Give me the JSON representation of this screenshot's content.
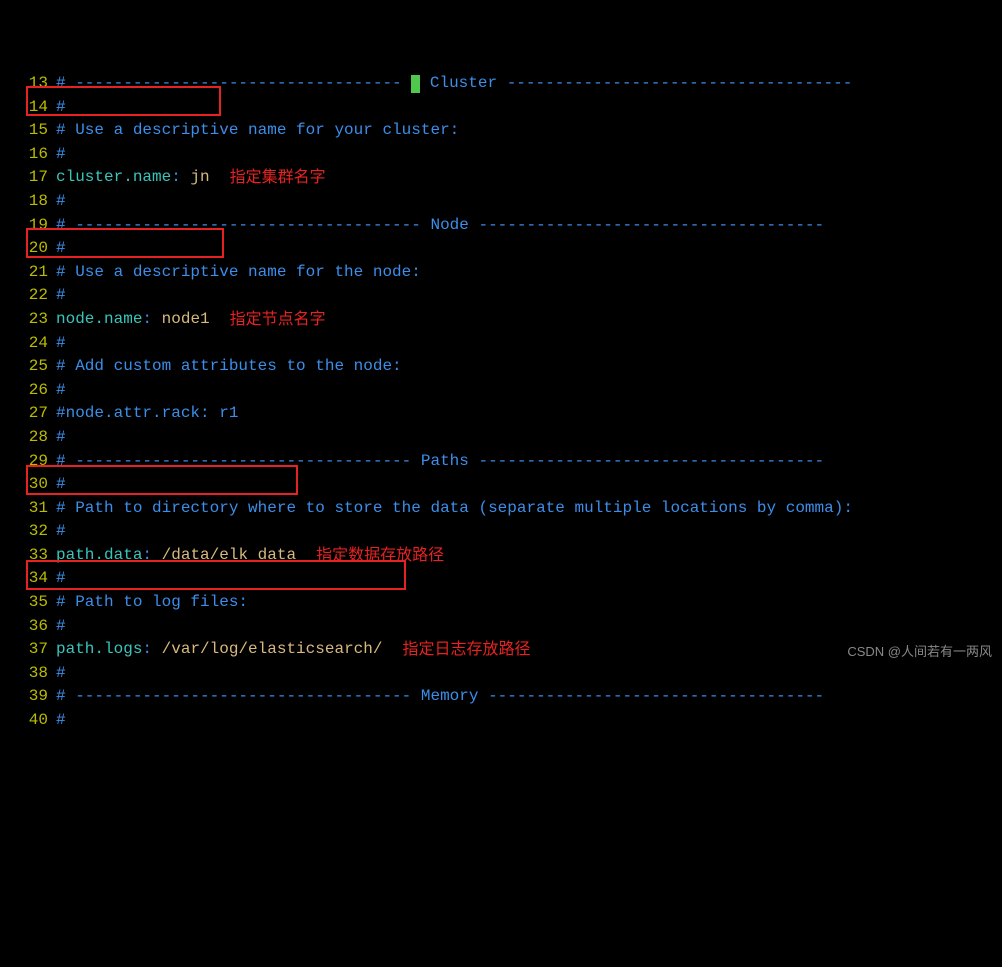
{
  "lines": {
    "13": {
      "num": "13",
      "dash_left": "# ---------------------------------- ",
      "cursor": true,
      "section": " Cluster ",
      "dash_right": "------------------------------------"
    },
    "14": {
      "num": "14",
      "text": "#"
    },
    "15": {
      "num": "15",
      "text": "# Use a descriptive name for your cluster:"
    },
    "16": {
      "num": "16",
      "text": "#"
    },
    "17": {
      "num": "17",
      "key": "cluster.name",
      "colon": ":",
      "value": " jn"
    },
    "18": {
      "num": "18",
      "text": "#"
    },
    "19": {
      "num": "19",
      "dash_left": "# ------------------------------------ ",
      "section": "Node",
      "dash_right": " ------------------------------------"
    },
    "20": {
      "num": "20",
      "text": "#"
    },
    "21": {
      "num": "21",
      "text": "# Use a descriptive name for the node:"
    },
    "22": {
      "num": "22",
      "text": "#"
    },
    "23": {
      "num": "23",
      "key": "node.name",
      "colon": ":",
      "value": " node1"
    },
    "24": {
      "num": "24",
      "text": "#"
    },
    "25": {
      "num": "25",
      "text": "# Add custom attributes to the node:"
    },
    "26": {
      "num": "26",
      "text": "#"
    },
    "27": {
      "num": "27",
      "text": "#node.attr.rack: r1"
    },
    "28": {
      "num": "28",
      "text": "#"
    },
    "29": {
      "num": "29",
      "dash_left": "# ----------------------------------- ",
      "section": "Paths",
      "dash_right": " ------------------------------------"
    },
    "30": {
      "num": "30",
      "text": "#"
    },
    "31": {
      "num": "31",
      "text": "# Path to directory where to store the data (separate multiple locations by comma):"
    },
    "32": {
      "num": "32",
      "text": "#"
    },
    "33": {
      "num": "33",
      "key": "path.data",
      "colon": ":",
      "value": " /data/elk_data"
    },
    "34": {
      "num": "34",
      "text": "#"
    },
    "35": {
      "num": "35",
      "text": "# Path to log files:"
    },
    "36": {
      "num": "36",
      "text": "#"
    },
    "37": {
      "num": "37",
      "key": "path.logs",
      "colon": ":",
      "value": " /var/log/elasticsearch/"
    },
    "38": {
      "num": "38",
      "text": "#"
    },
    "39": {
      "num": "39",
      "dash_left": "# ----------------------------------- ",
      "section": "Memory",
      "dash_right": " -----------------------------------"
    },
    "40": {
      "num": "40",
      "text": "#"
    }
  },
  "annotations": {
    "a17": "指定集群名字",
    "a23": "指定节点名字",
    "a33": "指定数据存放路径",
    "a37": "指定日志存放路径"
  },
  "watermark": "CSDN @人间若有一两风"
}
